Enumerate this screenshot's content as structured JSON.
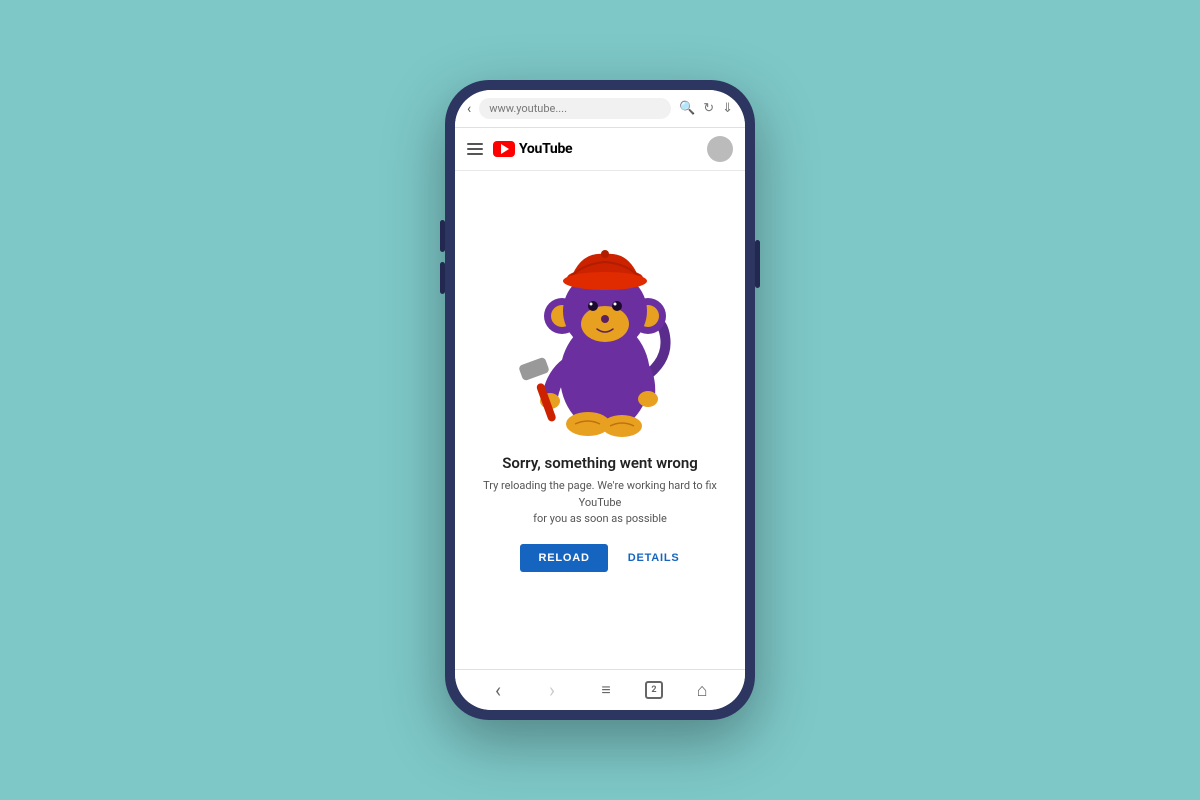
{
  "background_color": "#7ec8c8",
  "phone": {
    "brand_color": "#2d3561"
  },
  "browser": {
    "url": "www.youtube....",
    "back_label": "‹",
    "search_icon": "search",
    "refresh_icon": "refresh",
    "download_icon": "download"
  },
  "youtube_header": {
    "menu_icon": "hamburger",
    "logo_text": "YouTube",
    "avatar_icon": "avatar"
  },
  "error_page": {
    "title": "Sorry, something went wrong",
    "subtitle": "Try reloading the page. We're working hard to fix YouTube\nfor you as soon as possible",
    "reload_button": "RELOAD",
    "details_button": "DETAILS"
  },
  "bottom_nav": {
    "back_icon": "‹",
    "forward_icon": "›",
    "menu_icon": "≡",
    "tab_count": "2",
    "home_icon": "⌂"
  }
}
